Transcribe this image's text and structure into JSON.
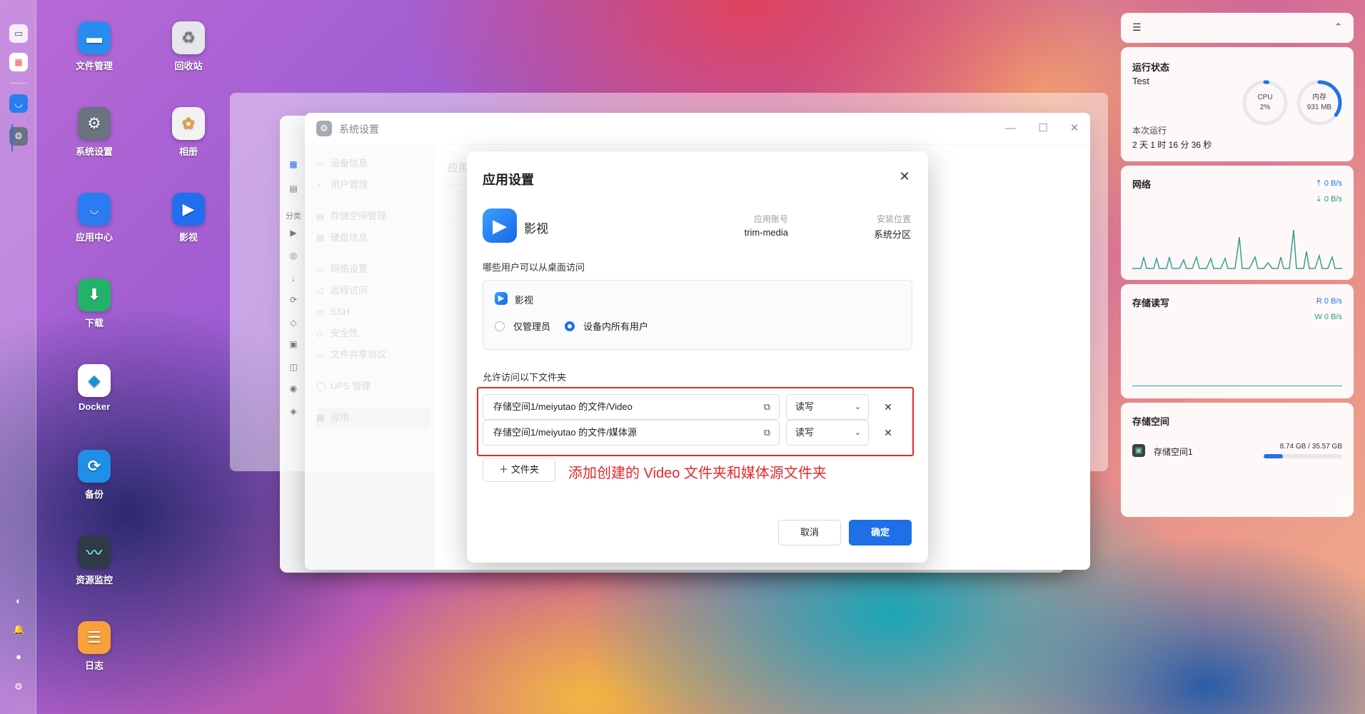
{
  "desktop": {
    "icons": [
      {
        "label": "文件管理",
        "icon": "folder-icon",
        "color": "#2b8cf0"
      },
      {
        "label": "回收站",
        "icon": "recycle-bin-icon",
        "color": "#d6d8dc"
      },
      {
        "label": "系统设置",
        "icon": "gear-icon",
        "color": "#6b7280"
      },
      {
        "label": "相册",
        "icon": "photos-icon",
        "color": "#f2f2f2"
      },
      {
        "label": "应用中心",
        "icon": "store-icon",
        "color": "#2b7cf0"
      },
      {
        "label": "影视",
        "icon": "media-icon",
        "color": "#1f6ff0"
      },
      {
        "label": "下载",
        "icon": "download-icon",
        "color": "#22b36a"
      },
      {
        "label": "Docker",
        "icon": "docker-icon",
        "color": "#ffffff"
      },
      {
        "label": "备份",
        "icon": "backup-icon",
        "color": "#1f8fe8"
      },
      {
        "label": "资源监控",
        "icon": "monitor-icon",
        "color": "#2f3a47"
      },
      {
        "label": "日志",
        "icon": "log-icon",
        "color": "#f7a13a"
      }
    ]
  },
  "settings_window": {
    "title": "系统设置",
    "nav": [
      {
        "label": "设备信息",
        "icon": "device-info-icon"
      },
      {
        "label": "用户管理",
        "icon": "user-icon"
      },
      {
        "label": "存储空间管理",
        "icon": "storage-icon"
      },
      {
        "label": "硬盘信息",
        "icon": "disk-icon"
      },
      {
        "label": "网络设置",
        "icon": "network-icon"
      },
      {
        "label": "远程访问",
        "icon": "remote-icon"
      },
      {
        "label": "SSH",
        "icon": "ssh-icon"
      },
      {
        "label": "安全性",
        "icon": "shield-icon"
      },
      {
        "label": "文件共享协议",
        "icon": "share-icon"
      },
      {
        "label": "UPS 管理",
        "icon": "ups-icon"
      },
      {
        "label": "应用",
        "icon": "apps-icon"
      }
    ],
    "content_label": "应用"
  },
  "side_strip": {
    "group_label": "分类"
  },
  "dialog": {
    "title": "应用设置",
    "app_name": "影视",
    "account_label": "应用账号",
    "account_value": "trim-media",
    "location_label": "安装位置",
    "location_value": "系统分区",
    "desktop_access_label": "哪些用户可以从桌面访问",
    "desktop_app_name": "影视",
    "radio_admin": "仅管理员",
    "radio_all": "设备内所有用户",
    "selected_radio": "all",
    "folders_label": "允许访问以下文件夹",
    "folders": [
      {
        "path": "存储空间1/meiyutao 的文件/Video",
        "permission": "读写"
      },
      {
        "path": "存储空间1/meiyutao 的文件/媒体源",
        "permission": "读写"
      }
    ],
    "add_folder": "文件夹",
    "annotation": "添加创建的 Video 文件夹和媒体源文件夹",
    "cancel": "取消",
    "ok": "确定"
  },
  "widgets": {
    "status": {
      "title": "运行状态",
      "device": "Test",
      "cpu_label": "CPU",
      "cpu_value": "2%",
      "cpu_fraction": 0.02,
      "mem_label": "内存",
      "mem_value": "931 MB",
      "mem_fraction": 0.35,
      "uptime_label": "本次运行",
      "uptime_value": "2 天 1 时 16 分 36 秒"
    },
    "network": {
      "title": "网络",
      "up": "0 B/s",
      "down": "0 B/s"
    },
    "disk_io": {
      "title": "存储读写",
      "read": "R 0 B/s",
      "write": "W 0 B/s"
    },
    "storage": {
      "title": "存储空间",
      "volume": "存储空间1",
      "usage": "8.74 GB / 35.57 GB",
      "fraction": 0.2457
    }
  },
  "colors": {
    "accent": "#1e6fe8",
    "annotation": "#e8262b",
    "chart": "#3a9f8f"
  }
}
